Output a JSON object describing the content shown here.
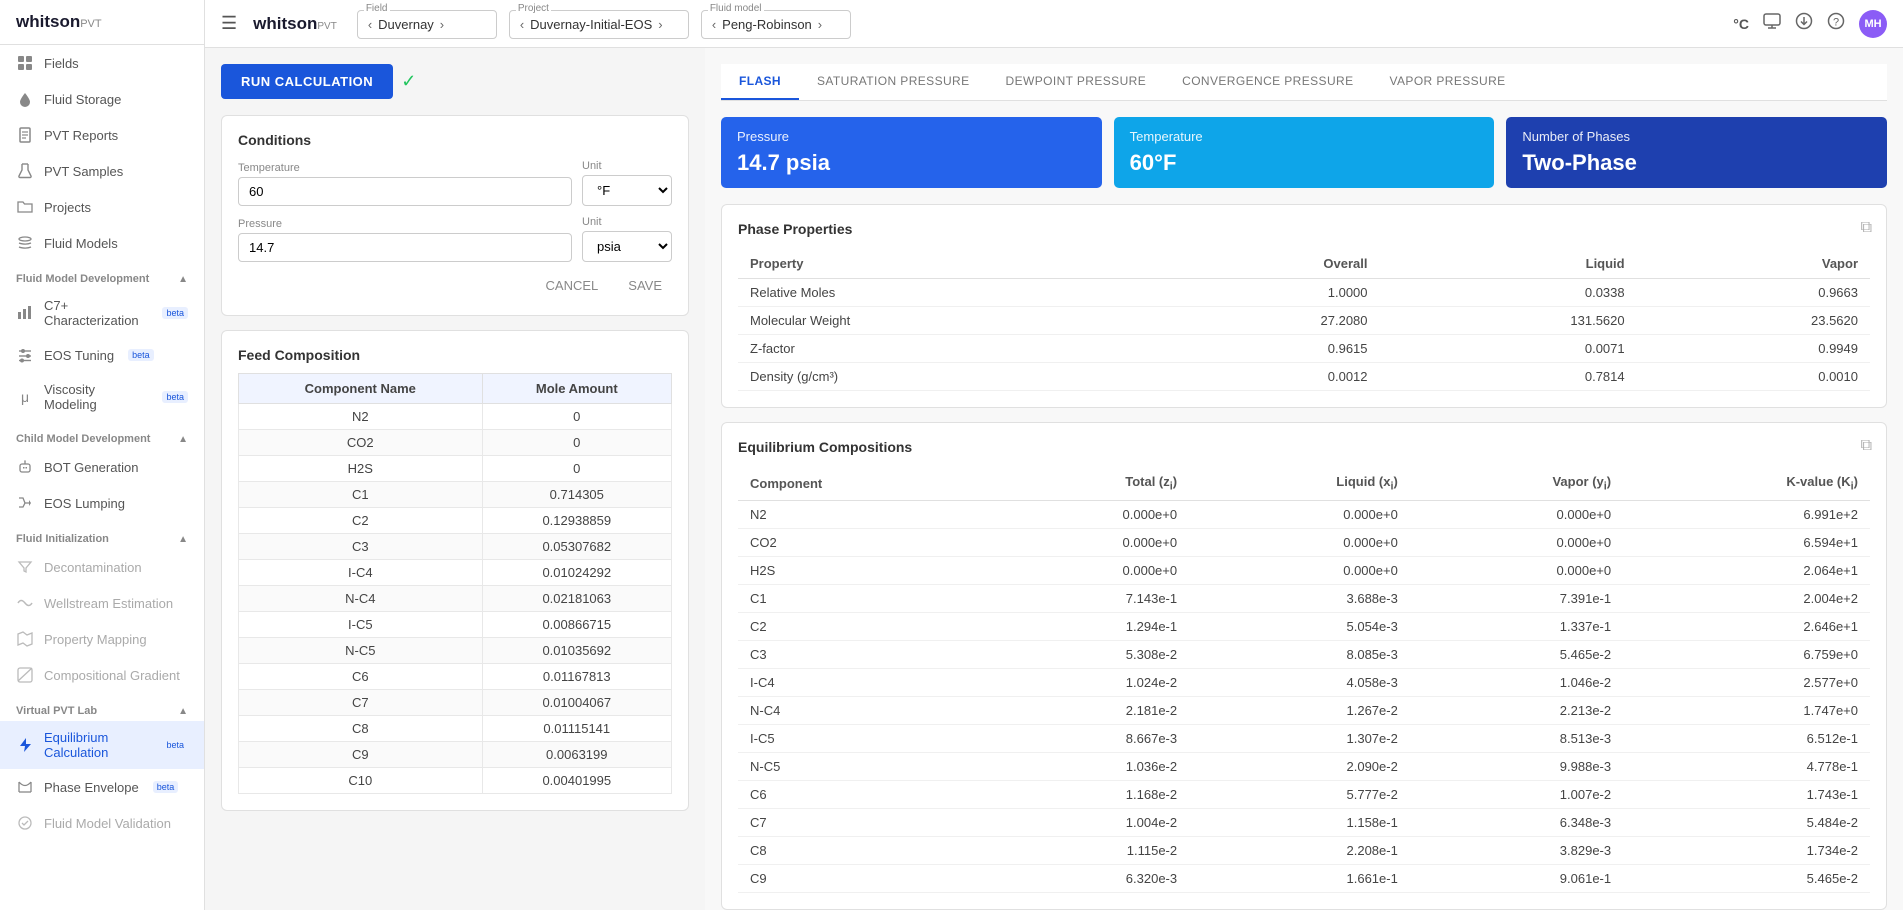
{
  "sidebar": {
    "logo": "whitson",
    "logo_suffix": "PVT",
    "items": [
      {
        "id": "fields",
        "label": "Fields",
        "icon": "grid"
      },
      {
        "id": "fluid-storage",
        "label": "Fluid Storage",
        "icon": "droplet"
      },
      {
        "id": "pvt-reports",
        "label": "PVT Reports",
        "icon": "file-text"
      },
      {
        "id": "pvt-samples",
        "label": "PVT Samples",
        "icon": "beaker"
      },
      {
        "id": "projects",
        "label": "Projects",
        "icon": "folder"
      },
      {
        "id": "fluid-models",
        "label": "Fluid Models",
        "icon": "layers"
      }
    ],
    "sections": [
      {
        "id": "fluid-model-dev",
        "label": "Fluid Model Development",
        "items": [
          {
            "id": "c7-char",
            "label": "C7+ Characterization",
            "badge": "beta",
            "icon": "chart-bar"
          },
          {
            "id": "eos-tuning",
            "label": "EOS Tuning",
            "badge": "beta",
            "icon": "tune"
          },
          {
            "id": "visc-modeling",
            "label": "Viscosity Modeling",
            "badge": "beta",
            "icon": "mu"
          }
        ]
      },
      {
        "id": "child-model-dev",
        "label": "Child Model Development",
        "items": [
          {
            "id": "bot-gen",
            "label": "BOT Generation",
            "icon": "bot"
          },
          {
            "id": "eos-lumping",
            "label": "EOS Lumping",
            "icon": "merge"
          }
        ]
      },
      {
        "id": "fluid-init",
        "label": "Fluid Initialization",
        "items": [
          {
            "id": "decontamination",
            "label": "Decontamination",
            "icon": "filter",
            "disabled": true
          },
          {
            "id": "wellstream-est",
            "label": "Wellstream Estimation",
            "icon": "stream",
            "disabled": true
          },
          {
            "id": "property-mapping",
            "label": "Property Mapping",
            "icon": "map",
            "disabled": true
          },
          {
            "id": "comp-gradient",
            "label": "Compositional Gradient",
            "icon": "gradient",
            "disabled": true
          }
        ]
      },
      {
        "id": "virtual-pvt",
        "label": "Virtual PVT Lab",
        "items": [
          {
            "id": "equil-calc",
            "label": "Equilibrium Calculation",
            "badge": "beta",
            "icon": "flash",
            "active": true
          },
          {
            "id": "phase-envelope",
            "label": "Phase Envelope",
            "badge": "beta",
            "icon": "envelope"
          },
          {
            "id": "fluid-model-val",
            "label": "Fluid Model Validation",
            "icon": "check-circle",
            "disabled": true
          }
        ]
      }
    ]
  },
  "topbar": {
    "menu_icon": "☰",
    "logo": "whitson",
    "logo_pvt": "PVT",
    "field": {
      "label": "Field",
      "value": "Duvernay"
    },
    "project": {
      "label": "Project",
      "value": "Duvernay-Initial-EOS"
    },
    "fluid_model": {
      "label": "Fluid model",
      "value": "Peng-Robinson"
    },
    "temp_unit": "°C",
    "avatar": "MH"
  },
  "run_button": "RUN CALCULATION",
  "conditions": {
    "title": "Conditions",
    "temperature": {
      "label": "Temperature",
      "value": "60",
      "unit": "°F"
    },
    "pressure": {
      "label": "Pressure",
      "value": "14.7",
      "unit": "psia"
    },
    "cancel_label": "CANCEL",
    "save_label": "SAVE"
  },
  "feed_composition": {
    "title": "Feed Composition",
    "headers": [
      "Component Name",
      "Mole Amount"
    ],
    "rows": [
      {
        "component": "N2",
        "mole": "0"
      },
      {
        "component": "CO2",
        "mole": "0"
      },
      {
        "component": "H2S",
        "mole": "0"
      },
      {
        "component": "C1",
        "mole": "0.714305"
      },
      {
        "component": "C2",
        "mole": "0.12938859"
      },
      {
        "component": "C3",
        "mole": "0.05307682"
      },
      {
        "component": "I-C4",
        "mole": "0.01024292"
      },
      {
        "component": "N-C4",
        "mole": "0.02181063"
      },
      {
        "component": "I-C5",
        "mole": "0.00866715"
      },
      {
        "component": "N-C5",
        "mole": "0.01035692"
      },
      {
        "component": "C6",
        "mole": "0.01167813"
      },
      {
        "component": "C7",
        "mole": "0.01004067"
      },
      {
        "component": "C8",
        "mole": "0.01115141"
      },
      {
        "component": "C9",
        "mole": "0.0063199"
      },
      {
        "component": "C10",
        "mole": "0.00401995"
      }
    ]
  },
  "tabs": [
    {
      "id": "flash",
      "label": "FLASH",
      "active": true
    },
    {
      "id": "saturation-pressure",
      "label": "SATURATION PRESSURE",
      "active": false
    },
    {
      "id": "dewpoint-pressure",
      "label": "DEWPOINT PRESSURE",
      "active": false
    },
    {
      "id": "convergence-pressure",
      "label": "CONVERGENCE PRESSURE",
      "active": false
    },
    {
      "id": "vapor-pressure",
      "label": "VAPOR PRESSURE",
      "active": false
    }
  ],
  "metrics": [
    {
      "id": "pressure",
      "label": "Pressure",
      "value": "14.7 psia",
      "color": "blue"
    },
    {
      "id": "temperature",
      "label": "Temperature",
      "value": "60°F",
      "color": "teal"
    },
    {
      "id": "num-phases",
      "label": "Number of Phases",
      "value": "Two-Phase",
      "color": "dark-blue"
    }
  ],
  "phase_properties": {
    "title": "Phase Properties",
    "headers": [
      "Property",
      "Overall",
      "Liquid",
      "Vapor"
    ],
    "rows": [
      {
        "property": "Relative Moles",
        "overall": "1.0000",
        "liquid": "0.0338",
        "vapor": "0.9663"
      },
      {
        "property": "Molecular Weight",
        "overall": "27.2080",
        "liquid": "131.5620",
        "vapor": "23.5620"
      },
      {
        "property": "Z-factor",
        "overall": "0.9615",
        "liquid": "0.0071",
        "vapor": "0.9949"
      },
      {
        "property": "Density (g/cm³)",
        "overall": "0.0012",
        "liquid": "0.7814",
        "vapor": "0.0010"
      }
    ]
  },
  "equilibrium_compositions": {
    "title": "Equilibrium Compositions",
    "headers": [
      "Component",
      "Total (zᵢ)",
      "Liquid (xᵢ)",
      "Vapor (yᵢ)",
      "K-value (Kᵢ)"
    ],
    "rows": [
      {
        "component": "N2",
        "total": "0.000e+0",
        "liquid": "0.000e+0",
        "vapor": "0.000e+0",
        "kvalue": "6.991e+2"
      },
      {
        "component": "CO2",
        "total": "0.000e+0",
        "liquid": "0.000e+0",
        "vapor": "0.000e+0",
        "kvalue": "6.594e+1"
      },
      {
        "component": "H2S",
        "total": "0.000e+0",
        "liquid": "0.000e+0",
        "vapor": "0.000e+0",
        "kvalue": "2.064e+1"
      },
      {
        "component": "C1",
        "total": "7.143e-1",
        "liquid": "3.688e-3",
        "vapor": "7.391e-1",
        "kvalue": "2.004e+2"
      },
      {
        "component": "C2",
        "total": "1.294e-1",
        "liquid": "5.054e-3",
        "vapor": "1.337e-1",
        "kvalue": "2.646e+1"
      },
      {
        "component": "C3",
        "total": "5.308e-2",
        "liquid": "8.085e-3",
        "vapor": "5.465e-2",
        "kvalue": "6.759e+0"
      },
      {
        "component": "I-C4",
        "total": "1.024e-2",
        "liquid": "4.058e-3",
        "vapor": "1.046e-2",
        "kvalue": "2.577e+0"
      },
      {
        "component": "N-C4",
        "total": "2.181e-2",
        "liquid": "1.267e-2",
        "vapor": "2.213e-2",
        "kvalue": "1.747e+0"
      },
      {
        "component": "I-C5",
        "total": "8.667e-3",
        "liquid": "1.307e-2",
        "vapor": "8.513e-3",
        "kvalue": "6.512e-1"
      },
      {
        "component": "N-C5",
        "total": "1.036e-2",
        "liquid": "2.090e-2",
        "vapor": "9.988e-3",
        "kvalue": "4.778e-1"
      },
      {
        "component": "C6",
        "total": "1.168e-2",
        "liquid": "5.777e-2",
        "vapor": "1.007e-2",
        "kvalue": "1.743e-1"
      },
      {
        "component": "C7",
        "total": "1.004e-2",
        "liquid": "1.158e-1",
        "vapor": "6.348e-3",
        "kvalue": "5.484e-2"
      },
      {
        "component": "C8",
        "total": "1.115e-2",
        "liquid": "2.208e-1",
        "vapor": "3.829e-3",
        "kvalue": "1.734e-2"
      },
      {
        "component": "C9",
        "total": "6.320e-3",
        "liquid": "1.661e-1",
        "vapor": "9.061e-1",
        "kvalue": "5.465e-2"
      }
    ]
  }
}
